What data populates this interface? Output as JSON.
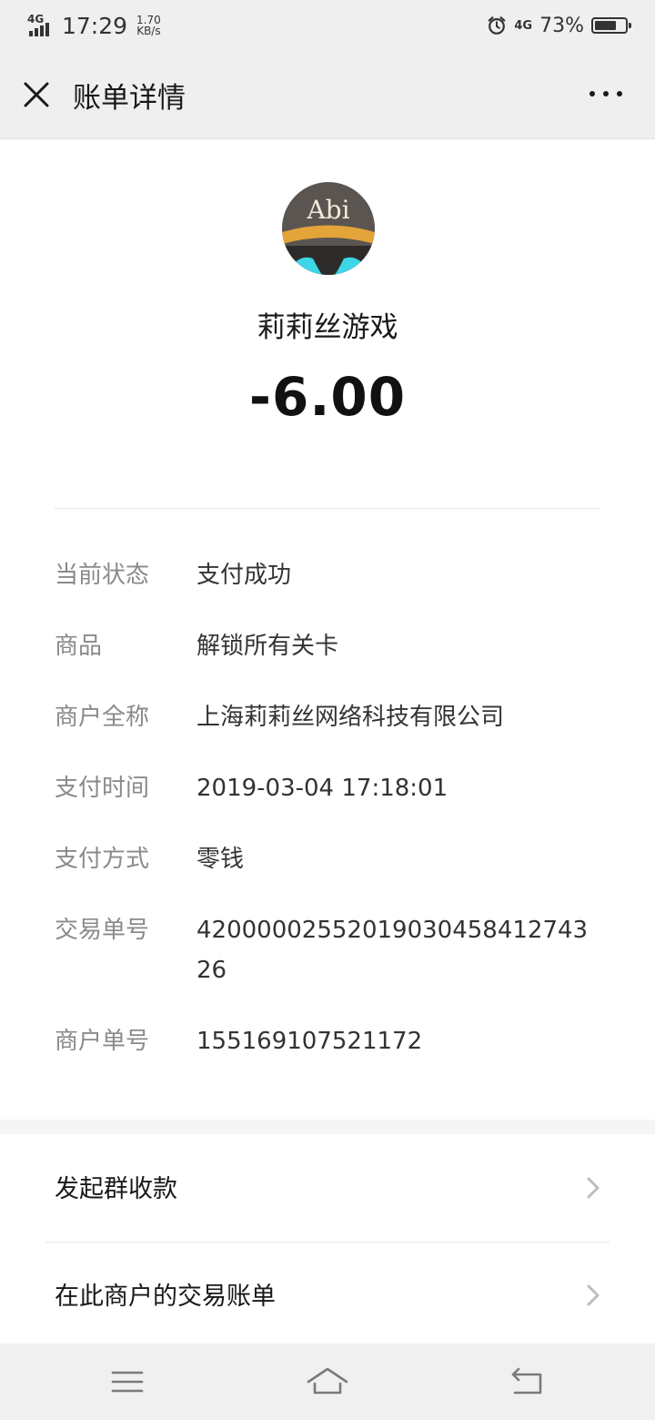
{
  "status_bar": {
    "network": "4G",
    "time": "17:29",
    "speed_value": "1.70",
    "speed_unit": "KB/s",
    "network_right": "4G",
    "battery_percent_text": "73%",
    "battery_level": 0.73,
    "icons": [
      "signal-icon",
      "alarm-icon",
      "battery-icon"
    ]
  },
  "header": {
    "title": "账单详情",
    "close_icon": "close-icon",
    "more_icon": "more-icon"
  },
  "summary": {
    "merchant_name": "莉莉丝游戏",
    "avatar_text": "Abi",
    "amount": "-6.00"
  },
  "details": [
    {
      "label": "当前状态",
      "value": "支付成功"
    },
    {
      "label": "商品",
      "value": "解锁所有关卡"
    },
    {
      "label": "商户全称",
      "value": "上海莉莉丝网络科技有限公司"
    },
    {
      "label": "支付时间",
      "value": "2019-03-04 17:18:01"
    },
    {
      "label": "支付方式",
      "value": "零钱"
    },
    {
      "label": "交易单号",
      "value": "4200000255201903045841274326"
    },
    {
      "label": "商户单号",
      "value": "155169107521172"
    }
  ],
  "actions": [
    {
      "label": "发起群收款",
      "icon": "chevron-right-icon"
    },
    {
      "label": "在此商户的交易账单",
      "icon": "chevron-right-icon"
    }
  ],
  "nav_bar": {
    "icons": [
      "menu-icon",
      "home-icon",
      "back-icon"
    ]
  },
  "colors": {
    "page_bg": "#ffffff",
    "bar_bg": "#efefef",
    "label_gray": "#8a8a8a",
    "text_dark": "#191919",
    "avatar_ring": "#e3a43a",
    "avatar_dark": "#5a5550",
    "avatar_cyan": "#3dd6e8"
  }
}
